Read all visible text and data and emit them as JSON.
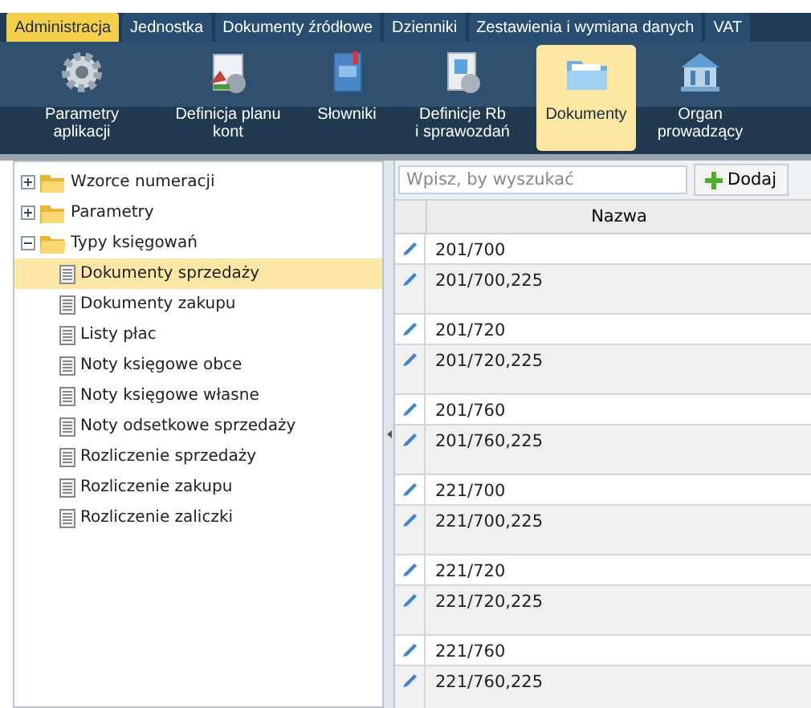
{
  "menu_tabs": [
    {
      "label": "Administracja",
      "selected": true
    },
    {
      "label": "Jednostka",
      "selected": false
    },
    {
      "label": "Dokumenty źródłowe",
      "selected": false
    },
    {
      "label": "Dzienniki",
      "selected": false
    },
    {
      "label": "Zestawienia i wymiana danych",
      "selected": false
    },
    {
      "label": "VAT",
      "selected": false
    }
  ],
  "toolbar": [
    {
      "kind": "gear",
      "label": "Parametry aplikacji",
      "selected": false
    },
    {
      "kind": "chart",
      "label": "Definicja planu kont",
      "selected": false
    },
    {
      "kind": "book",
      "label": "Słowniki",
      "selected": false
    },
    {
      "kind": "report",
      "label": "Definicje Rb i sprawozdań",
      "selected": false
    },
    {
      "kind": "folder",
      "label": "Dokumenty",
      "selected": true
    },
    {
      "kind": "bank",
      "label": "Organ prowadzący",
      "selected": false
    }
  ],
  "tree": [
    {
      "label": "Wzorce numeracji",
      "expanded": false,
      "selected": false
    },
    {
      "label": "Parametry",
      "expanded": false,
      "selected": false
    },
    {
      "label": "Typy księgowań",
      "expanded": true,
      "selected": false,
      "children": [
        {
          "label": "Dokumenty sprzedaży",
          "selected": true
        },
        {
          "label": "Dokumenty zakupu",
          "selected": false
        },
        {
          "label": "Listy płac",
          "selected": false
        },
        {
          "label": "Noty księgowe obce",
          "selected": false
        },
        {
          "label": "Noty księgowe własne",
          "selected": false
        },
        {
          "label": "Noty odsetkowe sprzedaży",
          "selected": false
        },
        {
          "label": "Rozliczenie sprzedaży",
          "selected": false
        },
        {
          "label": "Rozliczenie zakupu",
          "selected": false
        },
        {
          "label": "Rozliczenie zaliczki",
          "selected": false
        }
      ]
    }
  ],
  "search": {
    "placeholder": "Wpisz, by wyszukać"
  },
  "add_button": "Dodaj",
  "table": {
    "columns": [
      "Nazwa"
    ],
    "rows": [
      "201/700",
      "201/700,225",
      "201/720",
      "201/720,225",
      "201/760",
      "201/760,225",
      "221/700",
      "221/700,225",
      "221/720",
      "221/720,225",
      "221/760",
      "221/760,225"
    ]
  }
}
